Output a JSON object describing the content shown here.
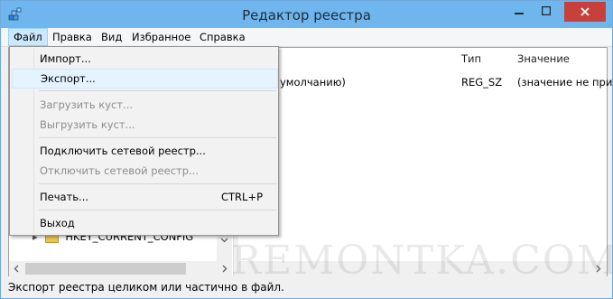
{
  "window": {
    "title": "Редактор реестра"
  },
  "menubar": {
    "file": "Файл",
    "edit": "Правка",
    "view": "Вид",
    "favorites": "Избранное",
    "help": "Справка"
  },
  "file_menu": {
    "import": "Импорт...",
    "export": "Экспорт...",
    "load_hive": "Загрузить куст...",
    "unload_hive": "Выгрузить куст...",
    "connect": "Подключить сетевой реестр...",
    "disconnect": "Отключить сетевой реестр...",
    "print": "Печать...",
    "print_shortcut": "CTRL+P",
    "exit": "Выход"
  },
  "list": {
    "headers": {
      "type": "Тип",
      "value": "Значение"
    },
    "rows": [
      {
        "name": "умолчанию)",
        "type": "REG_SZ",
        "value": "(значение не присв"
      }
    ]
  },
  "tree": {
    "visible_item": "HKEY_CURRENT_CONFIG"
  },
  "status": {
    "text": "Экспорт реестра целиком или частично в файл."
  },
  "watermark": "REMONTKA.COM",
  "colors": {
    "titlebar": "#6fb6ee",
    "close": "#c7413c",
    "menu_highlight": "#cce8ff"
  }
}
